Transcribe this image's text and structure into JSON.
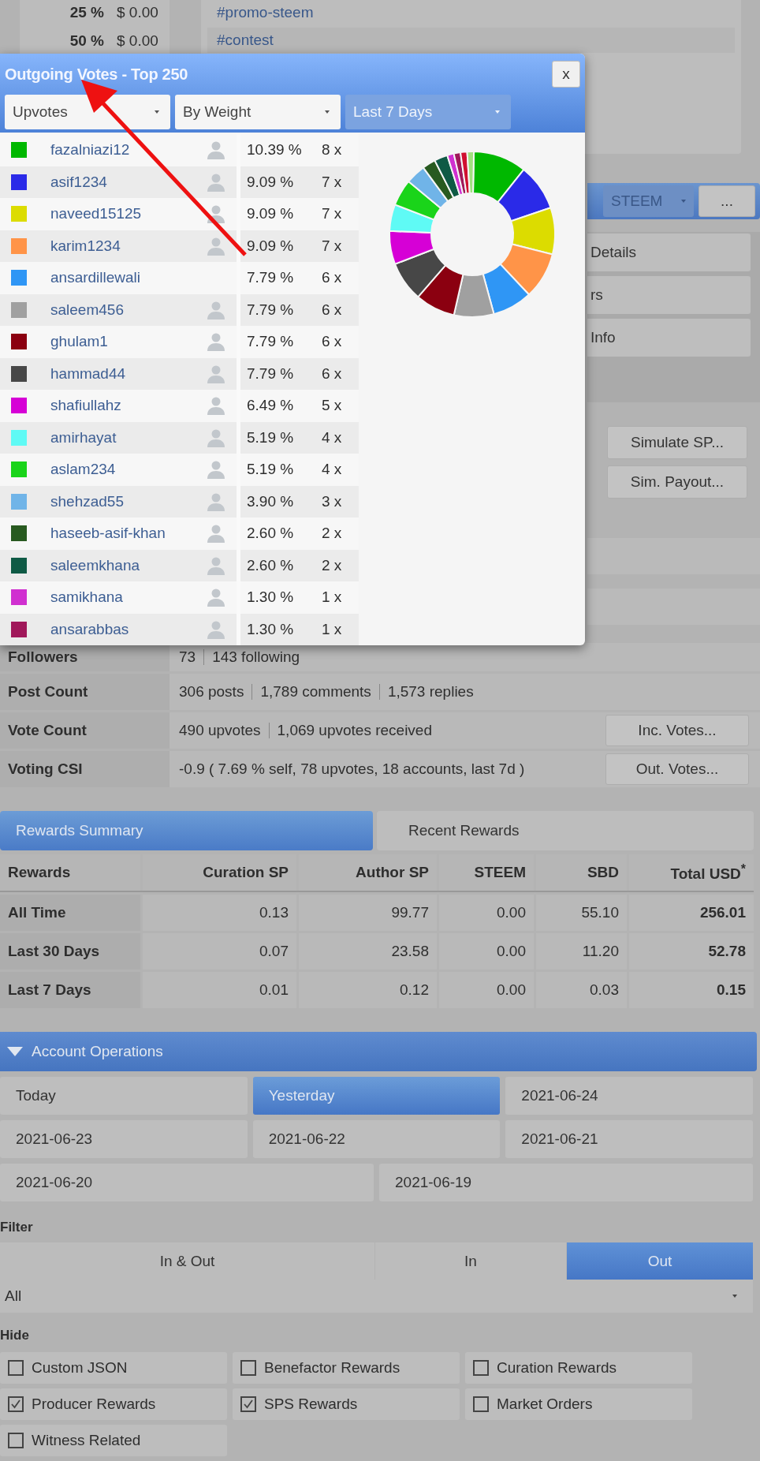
{
  "top_table": [
    {
      "percent": "25 %",
      "amount": "$ 0.00"
    },
    {
      "percent": "50 %",
      "amount": "$ 0.00"
    }
  ],
  "tags": [
    "#promo-steem",
    "#contest"
  ],
  "currency_select": {
    "value": "STEEM"
  },
  "more_button": "...",
  "section_buttons": [
    "Details",
    "rs",
    "Info"
  ],
  "simulate_buttons": [
    "Simulate SP...",
    "Sim. Payout..."
  ],
  "popup": {
    "title": "Outgoing Votes - Top 250",
    "close": "x",
    "selects": [
      {
        "value": "Upvotes",
        "disabled": false
      },
      {
        "value": "By Weight",
        "disabled": false
      },
      {
        "value": "Last 7 Days",
        "disabled": true
      }
    ],
    "rows": [
      {
        "color": "#00b800",
        "name": "fazalniazi12",
        "avatar": true,
        "share": "10.39 %",
        "count": "8 x"
      },
      {
        "color": "#2a2ae8",
        "name": "asif1234",
        "avatar": true,
        "share": "9.09 %",
        "count": "7 x"
      },
      {
        "color": "#dcdc00",
        "name": "naveed15125",
        "avatar": true,
        "share": "9.09 %",
        "count": "7 x"
      },
      {
        "color": "#ff9448",
        "name": "karim1234",
        "avatar": true,
        "share": "9.09 %",
        "count": "7 x"
      },
      {
        "color": "#2f96f5",
        "name": "ansardillewali",
        "avatar": false,
        "share": "7.79 %",
        "count": "6 x"
      },
      {
        "color": "#a0a0a0",
        "name": "saleem456",
        "avatar": true,
        "share": "7.79 %",
        "count": "6 x"
      },
      {
        "color": "#8b0010",
        "name": "ghulam1",
        "avatar": true,
        "share": "7.79 %",
        "count": "6 x"
      },
      {
        "color": "#474747",
        "name": "hammad44",
        "avatar": true,
        "share": "7.79 %",
        "count": "6 x"
      },
      {
        "color": "#d600d6",
        "name": "shafiullahz",
        "avatar": true,
        "share": "6.49 %",
        "count": "5 x"
      },
      {
        "color": "#5ffaf5",
        "name": "amirhayat",
        "avatar": true,
        "share": "5.19 %",
        "count": "4 x"
      },
      {
        "color": "#1ad41a",
        "name": "aslam234",
        "avatar": true,
        "share": "5.19 %",
        "count": "4 x"
      },
      {
        "color": "#70b4e8",
        "name": "shehzad55",
        "avatar": true,
        "share": "3.90 %",
        "count": "3 x"
      },
      {
        "color": "#285a20",
        "name": "haseeb-asif-khan",
        "avatar": true,
        "share": "2.60 %",
        "count": "2 x"
      },
      {
        "color": "#0f5a45",
        "name": "saleemkhana",
        "avatar": true,
        "share": "2.60 %",
        "count": "2 x"
      },
      {
        "color": "#d030d0",
        "name": "samikhana",
        "avatar": true,
        "share": "1.30 %",
        "count": "1 x"
      },
      {
        "color": "#a0185a",
        "name": "ansarabbas",
        "avatar": true,
        "share": "1.30 %",
        "count": "1 x"
      }
    ],
    "chart_data": {
      "type": "donut",
      "series": [
        {
          "values": [
            10.39,
            9.09,
            9.09,
            9.09,
            7.79,
            7.79,
            7.79,
            7.79,
            6.49,
            5.19,
            5.19,
            3.9,
            2.6,
            2.6,
            1.3,
            1.3,
            1.3,
            1.3
          ]
        }
      ],
      "colors": [
        "#00b800",
        "#2a2ae8",
        "#dcdc00",
        "#ff9448",
        "#2f96f5",
        "#a0a0a0",
        "#8b0010",
        "#474747",
        "#d600d6",
        "#5ffaf5",
        "#1ad41a",
        "#70b4e8",
        "#285a20",
        "#0f5a45",
        "#d030d0",
        "#a0185a",
        "#d01030",
        "#a0e080"
      ]
    }
  },
  "stats": [
    {
      "label": "Followers",
      "parts": [
        "73",
        "143 following"
      ]
    },
    {
      "label": "Post Count",
      "parts": [
        "306 posts",
        "1,789 comments",
        "1,573 replies"
      ]
    },
    {
      "label": "Vote Count",
      "parts": [
        "490 upvotes",
        "1,069 upvotes received"
      ],
      "button": "Inc. Votes..."
    },
    {
      "label": "Voting CSI",
      "parts": [
        "-0.9 ( 7.69 % self, 78 upvotes, 18 accounts, last 7d )"
      ],
      "button": "Out. Votes..."
    }
  ],
  "rewards_tabs": [
    {
      "label": "Rewards Summary",
      "selected": true
    },
    {
      "label": "Recent Rewards",
      "selected": false
    }
  ],
  "rewards_table": {
    "columns": [
      "Rewards",
      "Curation SP",
      "Author SP",
      "STEEM",
      "SBD",
      "Total USD$^{*}$"
    ],
    "rows": [
      [
        "All Time",
        "0.13",
        "99.77",
        "0.00",
        "55.10",
        "256.01"
      ],
      [
        "Last 30 Days",
        "0.07",
        "23.58",
        "0.00",
        "11.20",
        "52.78"
      ],
      [
        "Last 7 Days",
        "0.01",
        "0.12",
        "0.00",
        "0.03",
        "0.15"
      ]
    ]
  },
  "account_operations": {
    "title": "Account Operations",
    "expanded": true,
    "date_rows": [
      [
        {
          "label": "Today",
          "selected": false
        },
        {
          "label": "Yesterday",
          "selected": true
        },
        {
          "label": "2021-06-24",
          "selected": false
        }
      ],
      [
        {
          "label": "2021-06-23",
          "selected": false
        },
        {
          "label": "2021-06-22",
          "selected": false
        },
        {
          "label": "2021-06-21",
          "selected": false
        }
      ],
      [
        {
          "label": "2021-06-20",
          "selected": false
        },
        {
          "label": "2021-06-19",
          "selected": false
        }
      ]
    ],
    "filter_label": "Filter",
    "filter_options": [
      {
        "label": "In & Out",
        "selected": false
      },
      {
        "label": "In",
        "selected": false
      },
      {
        "label": "Out",
        "selected": true
      }
    ],
    "type_select": {
      "value": "All"
    },
    "hide_label": "Hide",
    "hide_options": [
      {
        "label": "Custom JSON",
        "checked": false
      },
      {
        "label": "Benefactor Rewards",
        "checked": false
      },
      {
        "label": "Curation Rewards",
        "checked": false
      },
      {
        "label": "Producer Rewards",
        "checked": true
      },
      {
        "label": "SPS Rewards",
        "checked": true
      },
      {
        "label": "Market Orders",
        "checked": false
      },
      {
        "label": "Witness Related",
        "checked": false
      }
    ]
  }
}
